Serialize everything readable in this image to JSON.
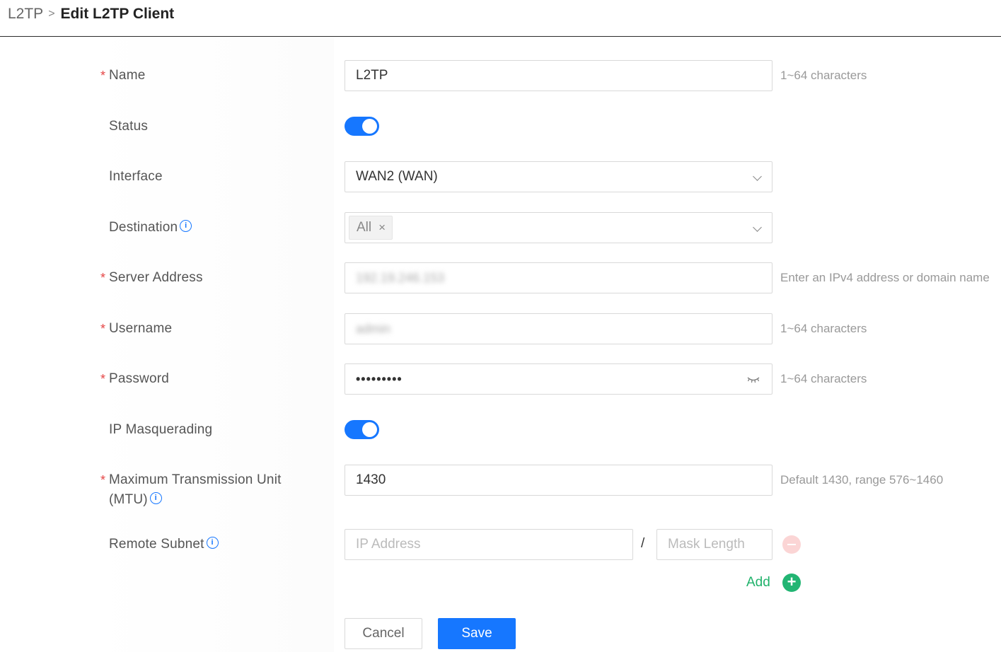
{
  "breadcrumb": {
    "parent": "L2TP",
    "separator": ">",
    "current": "Edit L2TP Client"
  },
  "form": {
    "name": {
      "label": "Name",
      "required": "*",
      "value": "L2TP",
      "hint": "1~64 characters"
    },
    "status": {
      "label": "Status",
      "enabled": true
    },
    "interface": {
      "label": "Interface",
      "value": "WAN2 (WAN)"
    },
    "destination": {
      "label": "Destination",
      "tag": "All",
      "tag_remove": "×"
    },
    "server_address": {
      "label": "Server Address",
      "required": "*",
      "value": "192.19.246.153",
      "hint": "Enter an IPv4 address or domain name"
    },
    "username": {
      "label": "Username",
      "required": "*",
      "value": "admin",
      "hint": "1~64 characters"
    },
    "password": {
      "label": "Password",
      "required": "*",
      "value": "•••••••••",
      "hint": "1~64 characters"
    },
    "ip_masquerading": {
      "label": "IP Masquerading",
      "enabled": true
    },
    "mtu": {
      "label_line1": "Maximum Transmission Unit",
      "label_line2": "(MTU)",
      "required": "*",
      "value": "1430",
      "hint": "Default 1430, range 576~1460"
    },
    "remote_subnet": {
      "label": "Remote Subnet",
      "ip_placeholder": "IP Address",
      "separator": "/",
      "mask_placeholder": "Mask Length",
      "add_label": "Add"
    }
  },
  "actions": {
    "cancel": "Cancel",
    "save": "Save"
  },
  "colors": {
    "accent": "#1677ff",
    "required": "#e54545",
    "add": "#22b573",
    "remove": "#fbd5d5"
  },
  "info_glyph": "i"
}
